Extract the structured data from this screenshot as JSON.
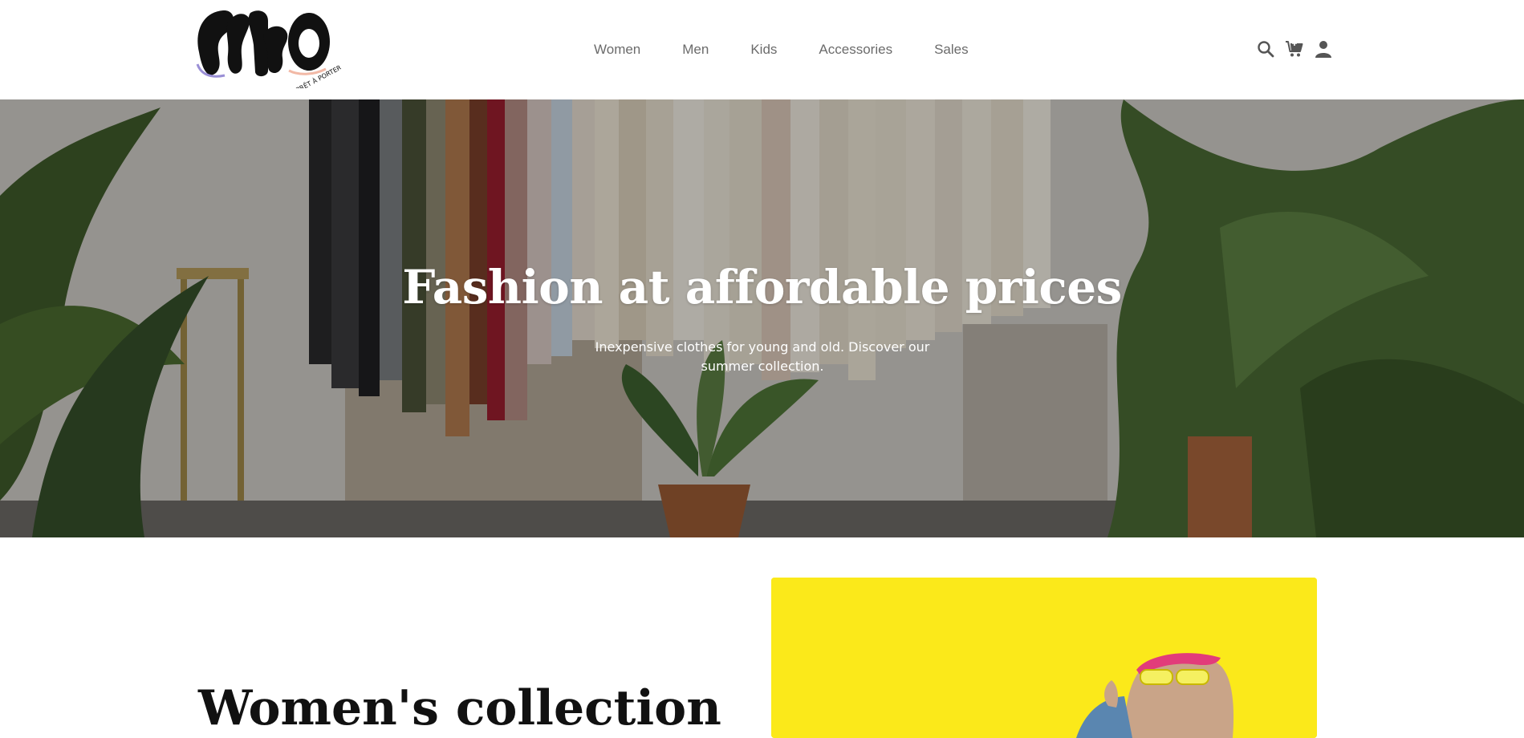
{
  "header": {
    "logo_text": "AKO",
    "logo_tagline": "PRÊT À PORTER",
    "nav": [
      {
        "label": "Women"
      },
      {
        "label": "Men"
      },
      {
        "label": "Kids"
      },
      {
        "label": "Accessories"
      },
      {
        "label": "Sales"
      }
    ],
    "icons": [
      "search-icon",
      "cart-icon",
      "user-icon"
    ]
  },
  "hero": {
    "title": "Fashion at affordable prices",
    "subtitle": "Inexpensive clothes for young and old. Discover our summer collection."
  },
  "collection": {
    "title": "Women's collection"
  },
  "colors": {
    "nav_text": "#6b6b6b",
    "feature_bg": "#fbe91a",
    "text_dark": "#111111"
  }
}
